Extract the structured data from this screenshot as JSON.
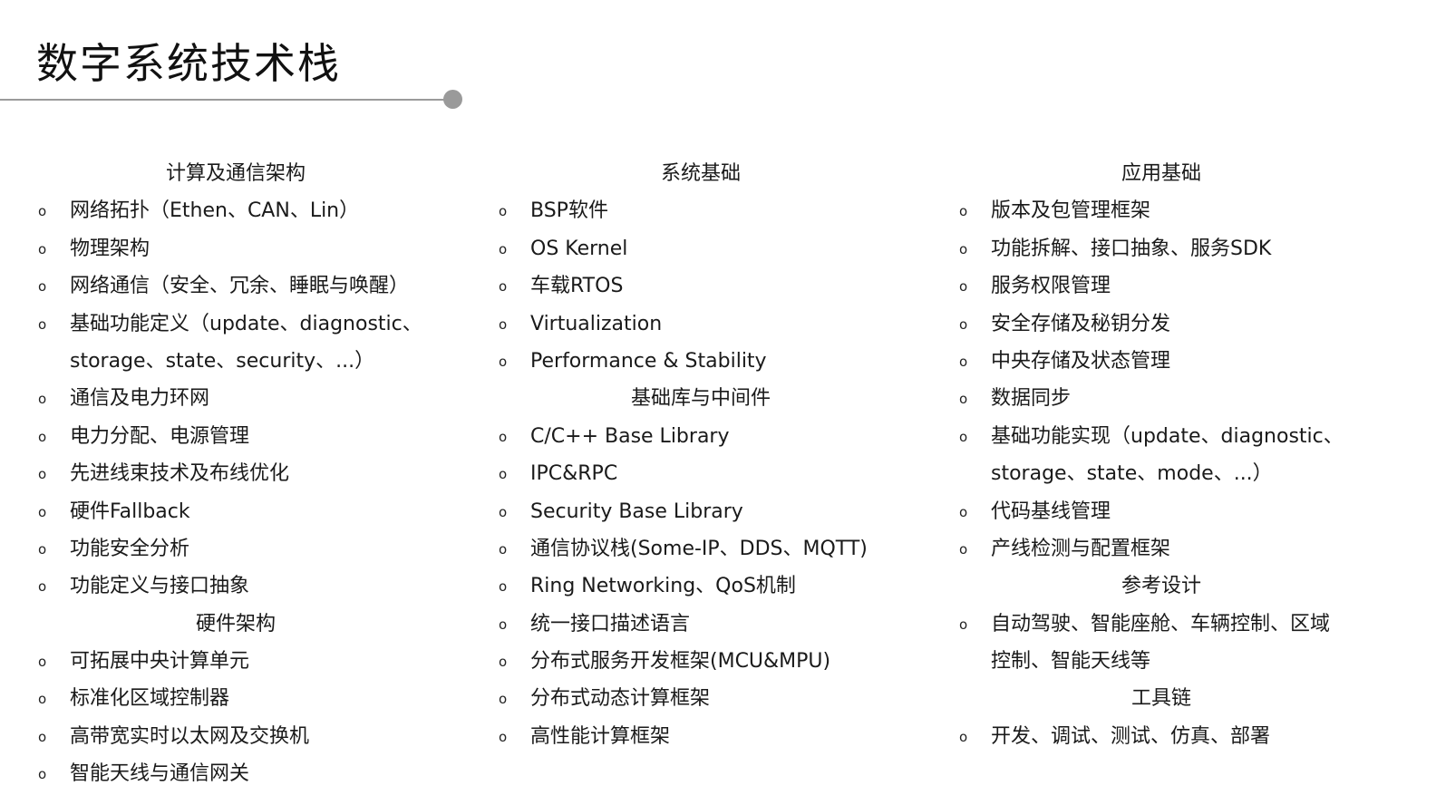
{
  "title": "数字系统技术栈",
  "columns": [
    {
      "rows": [
        {
          "kind": "heading",
          "text": "计算及通信架构"
        },
        {
          "kind": "item",
          "text": "网络拓扑（Ethen、CAN、Lin）"
        },
        {
          "kind": "item",
          "text": "物理架构"
        },
        {
          "kind": "item",
          "text": "网络通信（安全、冗余、睡眠与唤醒）"
        },
        {
          "kind": "item",
          "text": "基础功能定义（update、diagnostic、"
        },
        {
          "kind": "cont",
          "text": "storage、state、security、...）"
        },
        {
          "kind": "item",
          "text": "通信及电力环网"
        },
        {
          "kind": "item",
          "text": "电力分配、电源管理"
        },
        {
          "kind": "item",
          "text": "先进线束技术及布线优化"
        },
        {
          "kind": "item",
          "text": "硬件Fallback"
        },
        {
          "kind": "item",
          "text": "功能安全分析"
        },
        {
          "kind": "item",
          "text": "功能定义与接口抽象"
        },
        {
          "kind": "heading",
          "text": "硬件架构"
        },
        {
          "kind": "item",
          "text": "可拓展中央计算单元"
        },
        {
          "kind": "item",
          "text": "标准化区域控制器"
        },
        {
          "kind": "item",
          "text": "高带宽实时以太网及交换机"
        },
        {
          "kind": "item",
          "text": "智能天线与通信网关"
        }
      ]
    },
    {
      "rows": [
        {
          "kind": "heading",
          "text": "系统基础"
        },
        {
          "kind": "item",
          "text": "BSP软件"
        },
        {
          "kind": "item",
          "text": "OS Kernel"
        },
        {
          "kind": "item",
          "text": "车载RTOS"
        },
        {
          "kind": "item",
          "text": "Virtualization"
        },
        {
          "kind": "item",
          "text": "Performance & Stability"
        },
        {
          "kind": "heading",
          "text": "基础库与中间件"
        },
        {
          "kind": "item",
          "text": "C/C++ Base Library"
        },
        {
          "kind": "item",
          "text": "IPC&RPC"
        },
        {
          "kind": "item",
          "text": "Security Base Library"
        },
        {
          "kind": "item",
          "text": "通信协议栈(Some-IP、DDS、MQTT)"
        },
        {
          "kind": "item",
          "text": "Ring Networking、QoS机制"
        },
        {
          "kind": "item",
          "text": "统一接口描述语言"
        },
        {
          "kind": "item",
          "text": "分布式服务开发框架(MCU&MPU)"
        },
        {
          "kind": "item",
          "text": "分布式动态计算框架"
        },
        {
          "kind": "item",
          "text": "高性能计算框架"
        }
      ]
    },
    {
      "rows": [
        {
          "kind": "heading",
          "text": "应用基础"
        },
        {
          "kind": "item",
          "text": "版本及包管理框架"
        },
        {
          "kind": "item",
          "text": "功能拆解、接口抽象、服务SDK"
        },
        {
          "kind": "item",
          "text": "服务权限管理"
        },
        {
          "kind": "item",
          "text": "安全存储及秘钥分发"
        },
        {
          "kind": "item",
          "text": "中央存储及状态管理"
        },
        {
          "kind": "item",
          "text": "数据同步"
        },
        {
          "kind": "item",
          "text": "基础功能实现（update、diagnostic、"
        },
        {
          "kind": "cont",
          "text": "storage、state、mode、...）"
        },
        {
          "kind": "item",
          "text": "代码基线管理"
        },
        {
          "kind": "item",
          "text": "产线检测与配置框架"
        },
        {
          "kind": "heading",
          "text": "参考设计"
        },
        {
          "kind": "item",
          "text": "自动驾驶、智能座舱、车辆控制、区域"
        },
        {
          "kind": "cont",
          "text": "控制、智能天线等"
        },
        {
          "kind": "heading",
          "text": "工具链"
        },
        {
          "kind": "item",
          "text": "开发、调试、测试、仿真、部署"
        }
      ]
    }
  ]
}
